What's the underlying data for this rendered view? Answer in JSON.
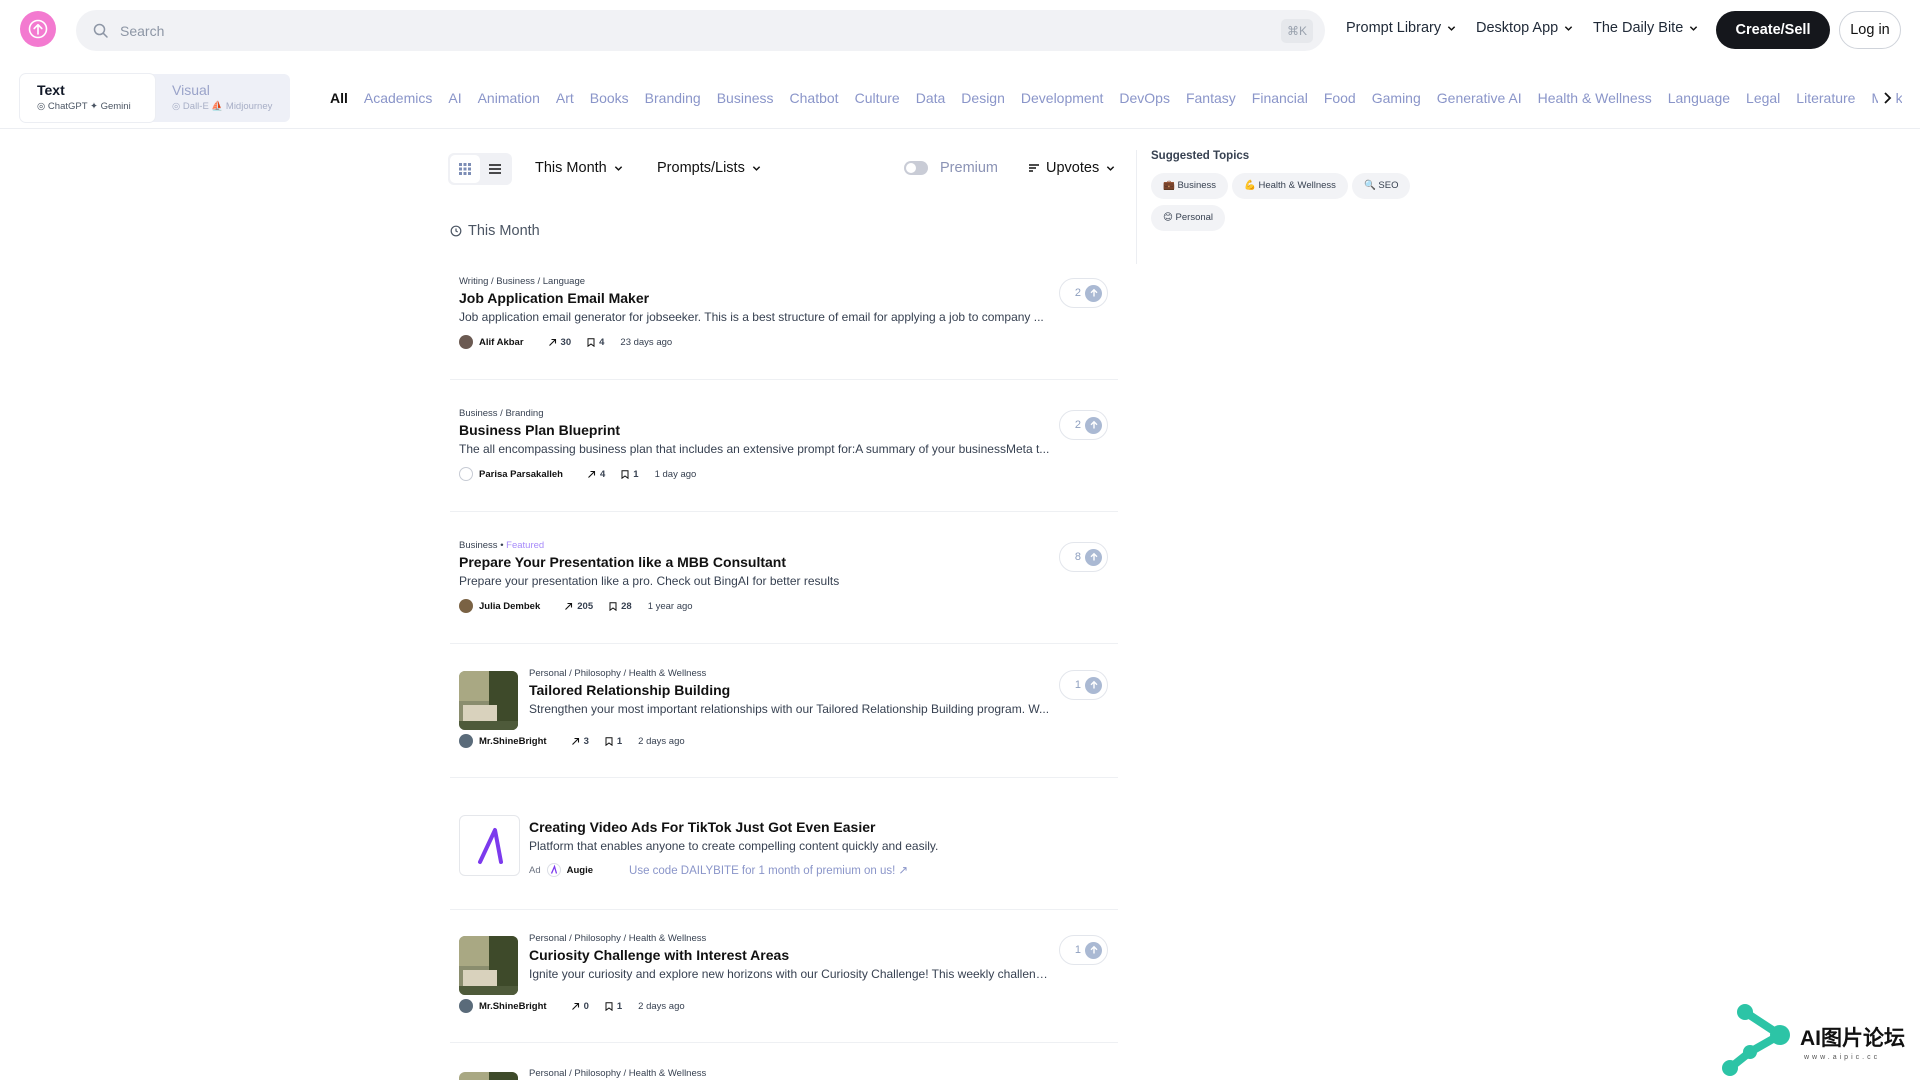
{
  "header": {
    "search_placeholder": "Search",
    "search_shortcut": "⌘K",
    "nav": [
      {
        "label": "Prompt Library"
      },
      {
        "label": "Desktop App"
      },
      {
        "label": "The Daily Bite"
      }
    ],
    "create_label": "Create/Sell",
    "login_label": "Log in"
  },
  "mode_switch": {
    "text": {
      "label": "Text",
      "sub": "◎ ChatGPT  ✦ Gemini"
    },
    "visual": {
      "label": "Visual",
      "sub": "◎ Dall-E  ⛵ Midjourney"
    }
  },
  "categories": [
    "All",
    "Academics",
    "AI",
    "Animation",
    "Art",
    "Books",
    "Branding",
    "Business",
    "Chatbot",
    "Culture",
    "Data",
    "Design",
    "Development",
    "DevOps",
    "Fantasy",
    "Financial",
    "Food",
    "Gaming",
    "Generative AI",
    "Health & Wellness",
    "Language",
    "Legal",
    "Literature",
    "Marketing"
  ],
  "toolbar": {
    "period": "This Month",
    "content_type": "Prompts/Lists",
    "premium_label": "Premium",
    "sort": "Upvotes"
  },
  "section": {
    "label": "This Month"
  },
  "feed": [
    {
      "crumbs": "Writing / Business / Language",
      "title": "Job Application Email Maker",
      "desc": "Job application email generator for jobseeker. This is a best structure of email for applying a job to company ...",
      "author": "Alif Akbar",
      "uses": "30",
      "saves": "4",
      "time": "23 days ago",
      "upvotes": "2"
    },
    {
      "crumbs": "Business / Branding",
      "title": "Business Plan Blueprint",
      "desc": "The all encompassing business plan that includes an extensive prompt for:A summary of your businessMeta t...",
      "author": "Parisa Parsakalleh",
      "uses": "4",
      "saves": "1",
      "time": "1 day ago",
      "upvotes": "2"
    },
    {
      "crumbs": "Business",
      "featured": "Featured",
      "title": "Prepare Your Presentation like a MBB Consultant",
      "desc": "Prepare your presentation like a pro. Check out BingAI for better results",
      "author": "Julia Dembek",
      "uses": "205",
      "saves": "28",
      "time": "1 year ago",
      "upvotes": "8"
    },
    {
      "crumbs": "Personal / Philosophy / Health & Wellness",
      "title": "Tailored Relationship Building",
      "desc": "Strengthen your most important relationships with our Tailored Relationship Building program. W...",
      "author": "Mr.ShineBright",
      "uses": "3",
      "saves": "1",
      "time": "2 days ago",
      "upvotes": "1"
    },
    {
      "crumbs": "Personal / Philosophy / Health & Wellness",
      "title": "Curiosity Challenge with Interest Areas",
      "desc": "Ignite your curiosity and explore new horizons with our Curiosity Challenge! This weekly challeng...",
      "author": "Mr.ShineBright",
      "uses": "0",
      "saves": "1",
      "time": "2 days ago",
      "upvotes": "1"
    },
    {
      "crumbs": "Personal / Philosophy / Health & Wellness"
    }
  ],
  "ad": {
    "title": "Creating Video Ads For TikTok Just Got Even Easier",
    "desc": "Platform that enables anyone to create compelling content quickly and easily.",
    "label": "Ad",
    "brand": "Augie",
    "promo": "Use code DAILYBITE for 1 month of premium on us! ↗"
  },
  "sidebar": {
    "title": "Suggested Topics",
    "topics": [
      "💼 Business",
      "💪 Health & Wellness",
      "🔍 SEO",
      "😊 Personal"
    ]
  },
  "watermark": {
    "text": "AI图片论坛",
    "sub": "www.aipic.cc"
  },
  "colors": {
    "accent": "#f37ad0",
    "link": "#8a95c9",
    "dark_button": "#15171c",
    "ad_brand": "#7c3aed"
  }
}
